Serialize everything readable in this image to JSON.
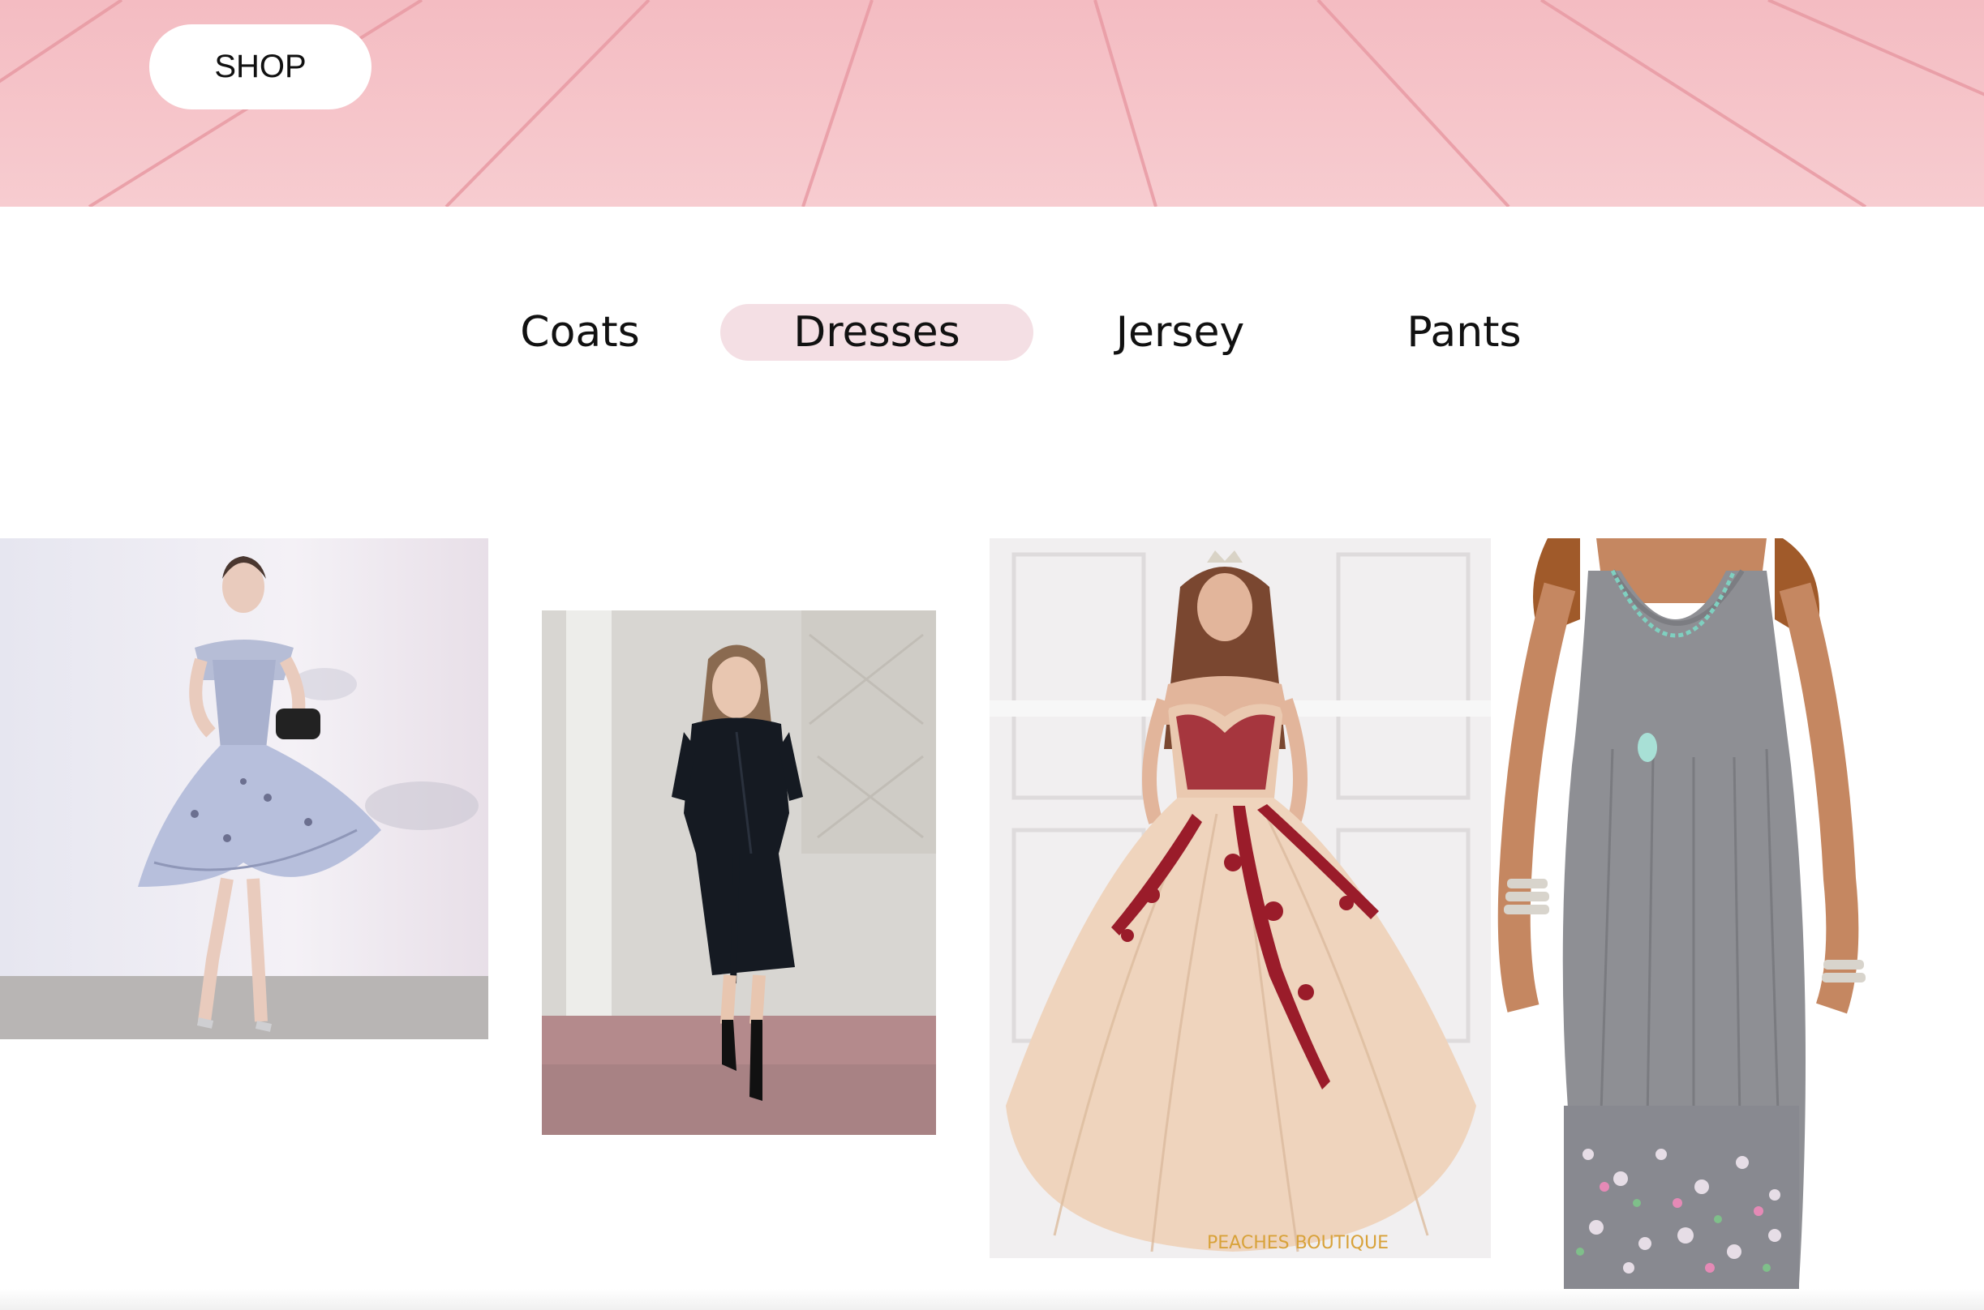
{
  "header": {
    "shop_label": "SHOP",
    "background_color": "#f6c5ca"
  },
  "tabs": [
    {
      "label": "Coats",
      "active": false
    },
    {
      "label": "Dresses",
      "active": true
    },
    {
      "label": "Jersey",
      "active": false
    },
    {
      "label": "Pants",
      "active": false
    }
  ],
  "accent_color": "#f4dfe4",
  "products": [
    {
      "name": "lavender-high-low-dress-photo"
    },
    {
      "name": "black-wrap-dress-photo"
    },
    {
      "name": "quinceanera-ball-gown-photo",
      "watermark": "PEACHES BOUTIQUE"
    },
    {
      "name": "grey-sleeveless-floral-hem-dress-photo"
    }
  ]
}
